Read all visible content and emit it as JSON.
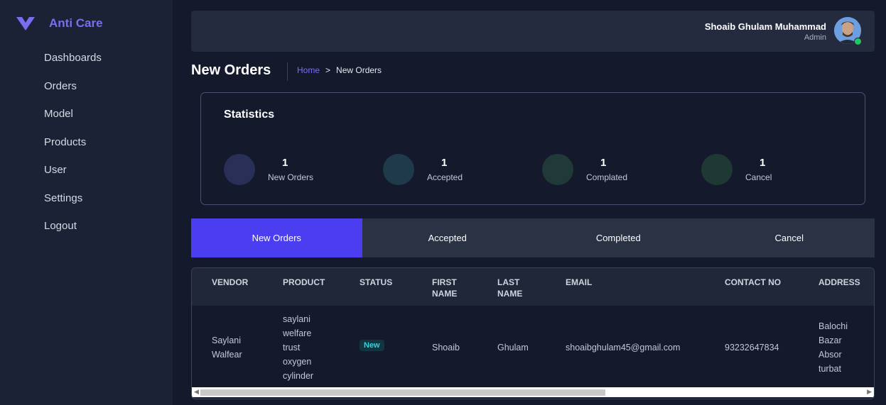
{
  "brand": {
    "name": "Anti Care",
    "logo_color": "#7c6cf2"
  },
  "sidebar": {
    "items": [
      {
        "label": "Dashboards"
      },
      {
        "label": "Orders"
      },
      {
        "label": "Model"
      },
      {
        "label": "Products"
      },
      {
        "label": "User"
      },
      {
        "label": "Settings"
      },
      {
        "label": "Logout"
      }
    ]
  },
  "header": {
    "user_name": "Shoaib Ghulam Muhammad",
    "user_role": "Admin"
  },
  "page": {
    "title": "New Orders",
    "breadcrumb": {
      "home": "Home",
      "separator": ">",
      "current": "New Orders"
    }
  },
  "statistics": {
    "title": "Statistics",
    "items": [
      {
        "value": "1",
        "label": "New Orders",
        "color": "#2a2f58"
      },
      {
        "value": "1",
        "label": "Accepted",
        "color": "#1f3a4a"
      },
      {
        "value": "1",
        "label": "Complated",
        "color": "#1f3a38"
      },
      {
        "value": "1",
        "label": "Cancel",
        "color": "#1e3834"
      }
    ]
  },
  "tabs": [
    {
      "label": "New Orders",
      "active": true
    },
    {
      "label": "Accepted",
      "active": false
    },
    {
      "label": "Completed",
      "active": false
    },
    {
      "label": "Cancel",
      "active": false
    }
  ],
  "table": {
    "columns": [
      "VENDOR",
      "PRODUCT",
      "STATUS",
      "FIRST NAME",
      "LAST NAME",
      "EMAIL",
      "CONTACT NO",
      "ADDRESS"
    ],
    "columns_lines": [
      [
        "VENDOR"
      ],
      [
        "PRODUCT"
      ],
      [
        "STATUS"
      ],
      [
        "FIRST",
        "NAME"
      ],
      [
        "LAST",
        "NAME"
      ],
      [
        "EMAIL"
      ],
      [
        "CONTACT NO"
      ],
      [
        "ADDRESS"
      ]
    ],
    "rows": [
      {
        "vendor": [
          "Saylani",
          "Walfear"
        ],
        "product": [
          "saylani",
          "welfare",
          "trust",
          "oxygen",
          "cylinder"
        ],
        "status": "New",
        "first_name": "Shoaib",
        "last_name": "Ghulam",
        "email": "shoaibghulam45@gmail.com",
        "contact_no": "93232647834",
        "address": [
          "Balochi",
          "Bazar",
          "Absor",
          "turbat"
        ]
      }
    ]
  },
  "colors": {
    "accent": "#4a3ef0",
    "status_new": "#2fd6e0",
    "online": "#22c55e"
  }
}
